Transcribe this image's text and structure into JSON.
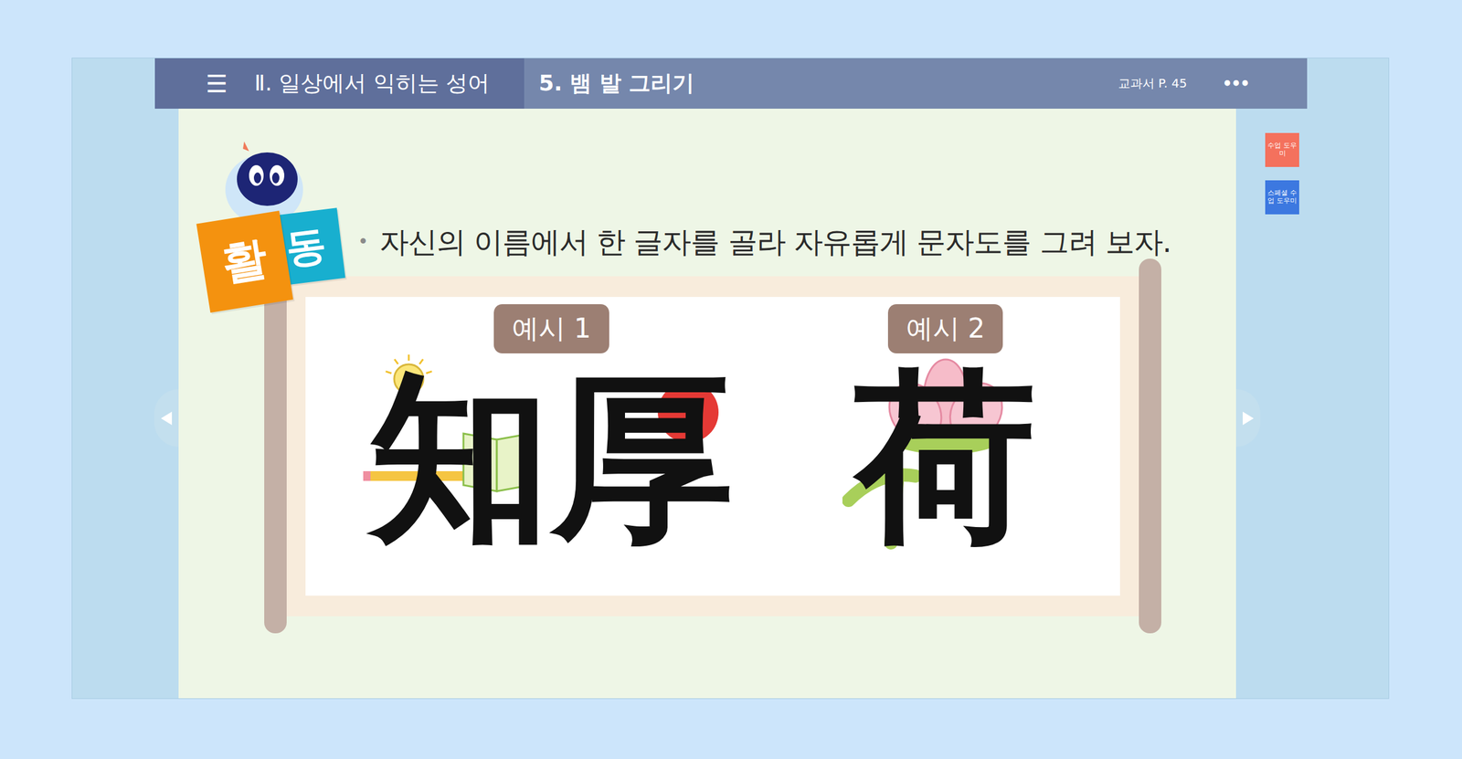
{
  "header": {
    "menu_icon": "☰",
    "section": "Ⅱ. 일상에서 익히는 성어",
    "lesson": "5. 뱀 발 그리기",
    "page": "교과서 P. 45",
    "more": "•••"
  },
  "side_buttons": [
    {
      "label": "수업 도우미",
      "color": "#f4715d"
    },
    {
      "label": "스페셜 수업 도우미",
      "color": "#3c78e0"
    }
  ],
  "activity_badge": [
    {
      "label": "활",
      "color": "#f4920f"
    },
    {
      "label": "동",
      "color": "#18afcf"
    }
  ],
  "instruction": {
    "bullet": "•",
    "text": "자신의 이름에서 한 글자를 골라 자유롭게 문자도를 그려 보자."
  },
  "examples": [
    {
      "label": "예시 1",
      "chars": "知厚",
      "kind": "study"
    },
    {
      "label": "예시 2",
      "chars": "荷",
      "kind": "lotus"
    }
  ]
}
